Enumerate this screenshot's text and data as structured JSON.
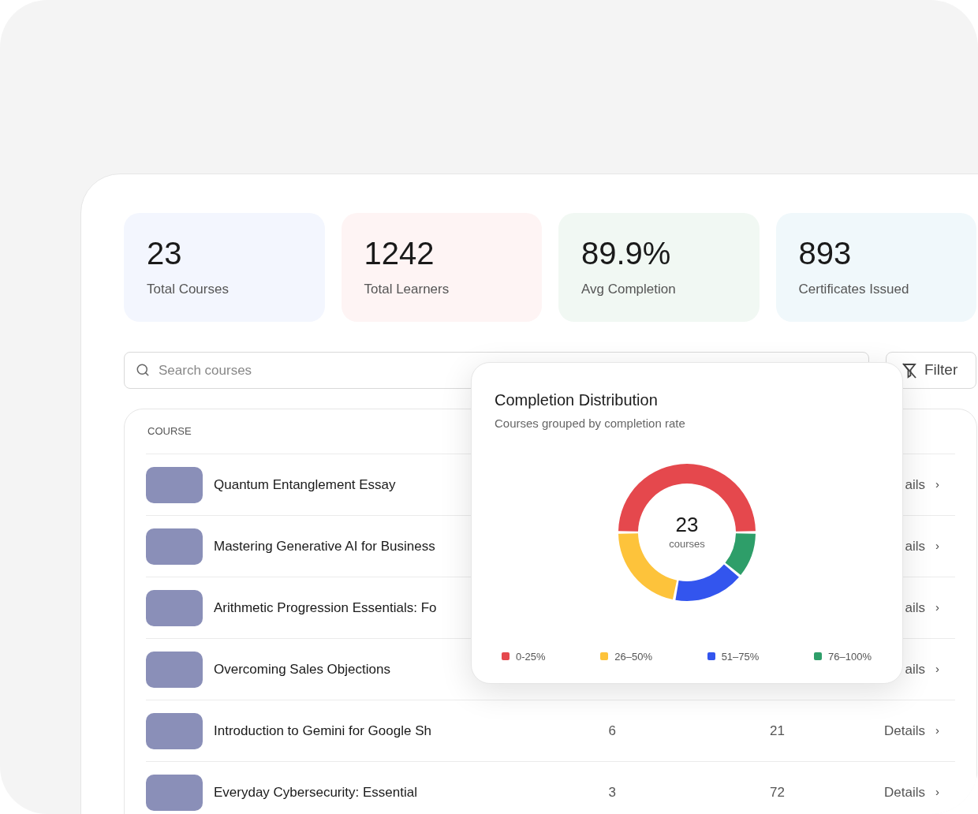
{
  "stats": [
    {
      "value": "23",
      "label": "Total Courses",
      "color": "#f3f6fe"
    },
    {
      "value": "1242",
      "label": "Total Learners",
      "color": "#fef4f4"
    },
    {
      "value": "89.9%",
      "label": "Avg Completion",
      "color": "#f1f8f3"
    },
    {
      "value": "893",
      "label": "Certificates Issued",
      "color": "#f0f8fb"
    }
  ],
  "search": {
    "placeholder": "Search courses"
  },
  "filter_button": "Filter",
  "table": {
    "columns": [
      "COURSE"
    ],
    "rows": [
      {
        "title": "Quantum Entanglement Essay",
        "details": "ails",
        "chevron": "›"
      },
      {
        "title": "Mastering Generative AI for Business",
        "details": "ails",
        "chevron": "›"
      },
      {
        "title": "Arithmetic Progression Essentials: Fo",
        "details": "ails",
        "chevron": "›"
      },
      {
        "title": "Overcoming Sales Objections",
        "details": "ails",
        "chevron": "›"
      },
      {
        "title": "Introduction to Gemini for Google Sh",
        "column_2": "6",
        "column_3": "21",
        "details": "Details",
        "chevron": "›"
      },
      {
        "title": "Everyday Cybersecurity: Essential",
        "column_2": "3",
        "column_3": "72",
        "details": "Details",
        "chevron": "›"
      }
    ]
  },
  "popover": {
    "title": "Completion Distribution",
    "subtitle": "Courses grouped by completion rate",
    "center_value": "23",
    "center_label": "courses",
    "legend": [
      {
        "label": "0-25%",
        "color": "#e5484d"
      },
      {
        "label": "26–50%",
        "color": "#fdc33b"
      },
      {
        "label": "51–75%",
        "color": "#3355ee"
      },
      {
        "label": "76–100%",
        "color": "#2e9e69"
      }
    ]
  }
}
